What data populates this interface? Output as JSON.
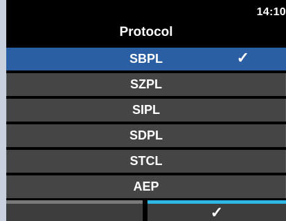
{
  "status": {
    "time": "14:10"
  },
  "header": {
    "title": "Protocol"
  },
  "protocols": {
    "items": [
      {
        "label": "SBPL",
        "selected": true
      },
      {
        "label": "SZPL",
        "selected": false
      },
      {
        "label": "SIPL",
        "selected": false
      },
      {
        "label": "SDPL",
        "selected": false
      },
      {
        "label": "STCL",
        "selected": false
      },
      {
        "label": "AEP",
        "selected": false
      }
    ],
    "check_glyph": "✓"
  },
  "footer": {
    "confirm_glyph": "✓",
    "left_icon": "back-button-blank",
    "right_icon": "check-icon"
  },
  "colors": {
    "selected": "#2b5fa3",
    "item": "#454545",
    "confirm_accent": "#2fb7e6",
    "back_accent": "#7a7a7a"
  }
}
